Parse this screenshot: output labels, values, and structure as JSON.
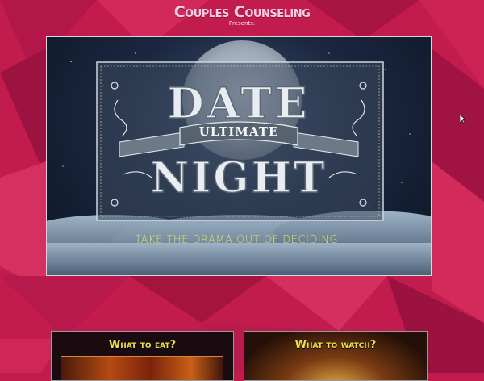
{
  "header": {
    "title": "Couples Counseling",
    "subtitle": "Presents:"
  },
  "hero": {
    "word_top": "DATE",
    "ribbon_text": "ULTIMATE",
    "word_bottom": "NIGHT",
    "tagline": "Take the drama out of deciding!"
  },
  "cards": [
    {
      "title": "What to eat?"
    },
    {
      "title": "What to watch?"
    }
  ],
  "colors": {
    "background": "#c21b4e",
    "title_pink": "#f7cfe0",
    "tagline_yellow": "#e3e25a",
    "card_title_yellow": "#e9e14a"
  }
}
